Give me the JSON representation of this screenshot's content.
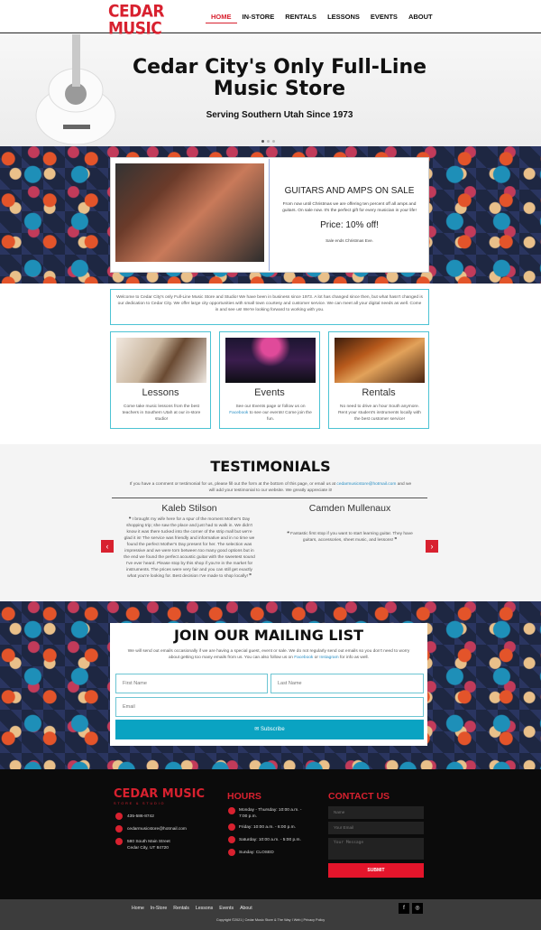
{
  "colors": {
    "brand_red": "#d8212f",
    "accent_teal": "#0aa3c2",
    "footer_bg": "#0b0b0b",
    "card_border": "#4cc3d4"
  },
  "logo": {
    "name": "CEDAR MUSIC",
    "tagline": "STORE & STUDIO"
  },
  "nav": {
    "items": [
      "HOME",
      "IN-STORE",
      "RENTALS",
      "LESSONS",
      "EVENTS",
      "ABOUT"
    ],
    "active": "HOME"
  },
  "hero": {
    "title": "Cedar City's Only Full-Line Music Store",
    "subtitle": "Serving Southern Utah Since 1973",
    "slide_count": 3,
    "active_slide": 1
  },
  "sale": {
    "title": "GUITARS AND AMPS ON SALE",
    "text": "From now until Christmas we are offering ten percent off all amps and guitars. On sale now. It's the perfect gift for every musician in your life!",
    "price": "Price: 10% off!",
    "ends": "Sale ends Christmas Eve."
  },
  "welcome": "Welcome to Cedar City's only Full-Line Music Store and Studio! We have been in business since 1973. A lot has changed since then, but what hasn't changed is our dedication to Cedar City. We offer large city opportunities with small town courtesy and customer service. We can meet all your digital needs as well. Come in and see us! We're looking forward to working with you.",
  "cards": [
    {
      "title": "Lessons",
      "text": "Come take music lessons from the best teachers in Southern Utah at our in-store studio!"
    },
    {
      "title": "Events",
      "text_before": "See our Events page or follow us on",
      "link": "Facebook",
      "text_after": "to see our events! Come join the fun."
    },
    {
      "title": "Rentals",
      "text": "No need to drive an hour South anymore. Rent your student's instruments locally with the best customer service!"
    }
  ],
  "testimonials": {
    "title": "TESTIMONIALS",
    "intro_before": "If you have a comment or testimonial for us, please fill out the form at the bottom of this page, or email us at",
    "email": "cedarmusicstore@hotmail.com",
    "intro_after": "and we will add your testimonial to our website. We greatly appreciate it!",
    "items": [
      {
        "name": "Kaleb Stilson",
        "quote": "I brought my wife here for a spur of the moment Mother's Day shopping trip; she saw the place and just had to walk in. We didn't know it was there tucked into the corner of the strip mall but we're glad it is! The service was friendly and informative and in no time we found the perfect Mother's Day present for her. The selection was impressive and we were torn between too many good options but in the end we found the perfect acoustic guitar with the sweetest sound I've ever heard. Please stop by this shop if you're in the market for instruments. The prices were very fair and you can still get exactly what you're looking for. Best decision I've made to shop locally!"
      },
      {
        "name": "Camden Mullenaux",
        "quote": "Fantastic first stop if you want to start learning guitar. They have guitars, accessories, sheet music, and lessons!"
      }
    ]
  },
  "mailing": {
    "title": "JOIN OUR MAILING LIST",
    "text_before": "We will send out emails occasionally if we are having a special guest, event or sale. We do not regularly send out emails so you don't need to worry about getting too many emails from us. You can also follow us on",
    "link1": "Facebook",
    "text_mid": "or",
    "link2": "Instagram",
    "text_after": "for info as well.",
    "first_placeholder": "First Name",
    "last_placeholder": "Last Name",
    "email_placeholder": "Email",
    "button": "Subscribe"
  },
  "footer": {
    "phone": "435-586-8742",
    "email": "cedarmusicstore@hotmail.com",
    "address1": "580 South Main Street",
    "address2": "Cedar City, UT 84720",
    "hours_title": "HOURS",
    "hours": [
      "Monday - Thursday: 10:00 a.m. - 7:00 p.m.",
      "Friday: 10:00 a.m. - 6:00 p.m.",
      "Saturday: 10:00 a.m. - 5:00 p.m.",
      "Sunday: CLOSED"
    ],
    "contact_title": "CONTACT US",
    "name_placeholder": "Name",
    "email_placeholder": "Your Email",
    "message_placeholder": "Your Message",
    "submit": "SUBMIT"
  },
  "bottom": {
    "nav": [
      "Home",
      "In-Store",
      "Rentals",
      "Lessons",
      "Events",
      "About"
    ],
    "copyright": "Copyright ©2021 | Cedar Music Store & The Way I Web | Privacy Policy",
    "social": [
      "facebook-icon",
      "instagram-icon"
    ]
  }
}
